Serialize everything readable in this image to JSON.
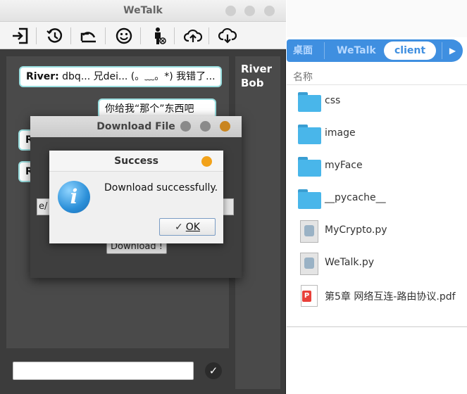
{
  "wetalk": {
    "title": "WeTalk",
    "toolbar": [
      {
        "icon": "logout-icon"
      },
      {
        "icon": "history-icon"
      },
      {
        "icon": "undo-icon"
      },
      {
        "icon": "emoji-icon"
      },
      {
        "icon": "user-status-icon"
      },
      {
        "icon": "upload-cloud-icon"
      },
      {
        "icon": "download-cloud-icon"
      }
    ],
    "messages": [
      {
        "sender": "River:",
        "text": " dbq... 兄dei... (。﹏。*) 我错了..."
      },
      {
        "sender": "",
        "text": "你给我“那个”东西吧"
      },
      {
        "sender": "R",
        "text": ""
      },
      {
        "sender": "R",
        "text": ""
      }
    ],
    "users": [
      "River",
      "Bob"
    ],
    "input_value": ""
  },
  "files": {
    "breadcrumbs": [
      "桌面",
      "WeTalk",
      "client"
    ],
    "column_name": "名称",
    "items": [
      {
        "name": "css",
        "type": "folder"
      },
      {
        "name": "image",
        "type": "folder"
      },
      {
        "name": "myFace",
        "type": "folder"
      },
      {
        "name": "__pycache__",
        "type": "folder"
      },
      {
        "name": "MyCrypto.py",
        "type": "python"
      },
      {
        "name": "WeTalk.py",
        "type": "python"
      },
      {
        "name": "第5章 网络互连-路由协议.pdf",
        "type": "pdf"
      }
    ]
  },
  "download_dialog": {
    "title": "Download File",
    "input_value": "e/",
    "button_label": "Download !"
  },
  "success_box": {
    "title": "Success",
    "icon_glyph": "i",
    "message": "Download successfully.",
    "ok_label": "OK"
  },
  "colors": {
    "accent_blue": "#3f8fe0",
    "bubble_border": "#9adfe0",
    "window_dark": "#3c3c3c",
    "close_orange": "#f2a21a"
  }
}
